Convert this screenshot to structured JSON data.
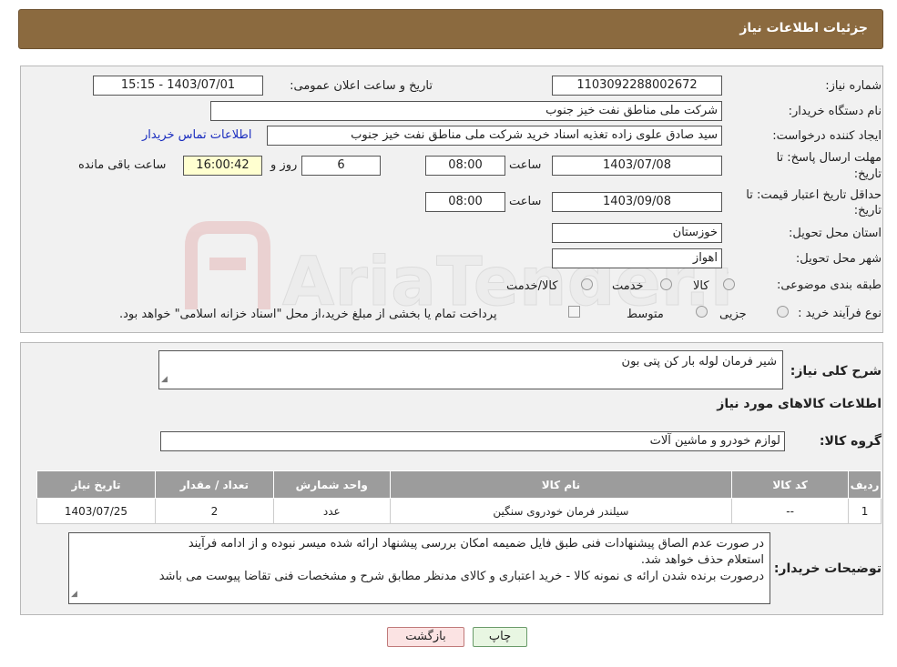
{
  "header": {
    "title": "جزئیات اطلاعات نیاز"
  },
  "form": {
    "need_number_label": "شماره نیاز:",
    "need_number": "1103092288002672",
    "announce_label": "تاریخ و ساعت اعلان عمومی:",
    "announce_value": "1403/07/01 - 15:15",
    "buyer_org_label": "نام دستگاه خریدار:",
    "buyer_org": "شرکت ملی مناطق نفت خیز جنوب",
    "creator_label": "ایجاد کننده درخواست:",
    "creator": "سید صادق علوی زاده  تغذیه اسناد خرید  شرکت ملی مناطق نفت خیز جنوب",
    "contact_link": "اطلاعات تماس خریدار",
    "deadline_label_1": "مهلت ارسال پاسخ: تا",
    "deadline_label_2": "تاریخ:",
    "deadline_date": "1403/07/08",
    "time_label": "ساعت",
    "deadline_time": "08:00",
    "days_value": "6",
    "days_label": "روز و",
    "remaining_time": "16:00:42",
    "remaining_label": "ساعت باقی مانده",
    "validity_label_1": "حداقل تاریخ اعتبار قیمت: تا",
    "validity_label_2": "تاریخ:",
    "validity_date": "1403/09/08",
    "validity_time": "08:00",
    "province_label": "استان محل تحویل:",
    "province": "خوزستان",
    "city_label": "شهر محل تحویل:",
    "city": "اهواز",
    "category_label": "طبقه بندی موضوعی:",
    "category_options": [
      "کالا",
      "خدمت",
      "کالا/خدمت"
    ],
    "purchase_type_label": "نوع فرآیند خرید :",
    "purchase_options": [
      "جزیی",
      "متوسط"
    ],
    "payment_note": "پرداخت تمام یا بخشی از مبلغ خرید،از محل \"اسناد خزانه اسلامی\" خواهد بود."
  },
  "summary": {
    "label": "شرح کلی نیاز:",
    "value": "شیر فرمان لوله بار کن پتی بون",
    "items_title": "اطلاعات کالاهای مورد نیاز",
    "group_label": "گروه کالا:",
    "group_value": "لوازم خودرو و ماشین آلات"
  },
  "table": {
    "headers": [
      "ردیف",
      "کد کالا",
      "نام کالا",
      "واحد شمارش",
      "تعداد / مقدار",
      "تاریخ نیاز"
    ],
    "rows": [
      [
        "1",
        "--",
        "سیلندر فرمان خودروی سنگین",
        "عدد",
        "2",
        "1403/07/25"
      ]
    ]
  },
  "buyer_notes": {
    "label": "توضیحات خریدار:",
    "line1": "در صورت عدم الصاق پیشنهادات فنی طبق فایل ضمیمه امکان بررسی پیشنهاد ارائه شده میسر نبوده و از ادامه فرآیند",
    "line2": "استعلام حذف خواهد شد.",
    "line3": "درصورت برنده شدن ارائه ی نمونه کالا - خرید اعتباری و کالای مدنظر مطابق شرح و مشخصات فنی تقاضا پیوست می باشد"
  },
  "buttons": {
    "print": "چاپ",
    "back": "بازگشت"
  },
  "watermark": {
    "text": "AriaTender.neT"
  },
  "colors": {
    "header": "#8b6a3f",
    "table_header": "#9c9c9c",
    "link": "#1a2dbf"
  }
}
